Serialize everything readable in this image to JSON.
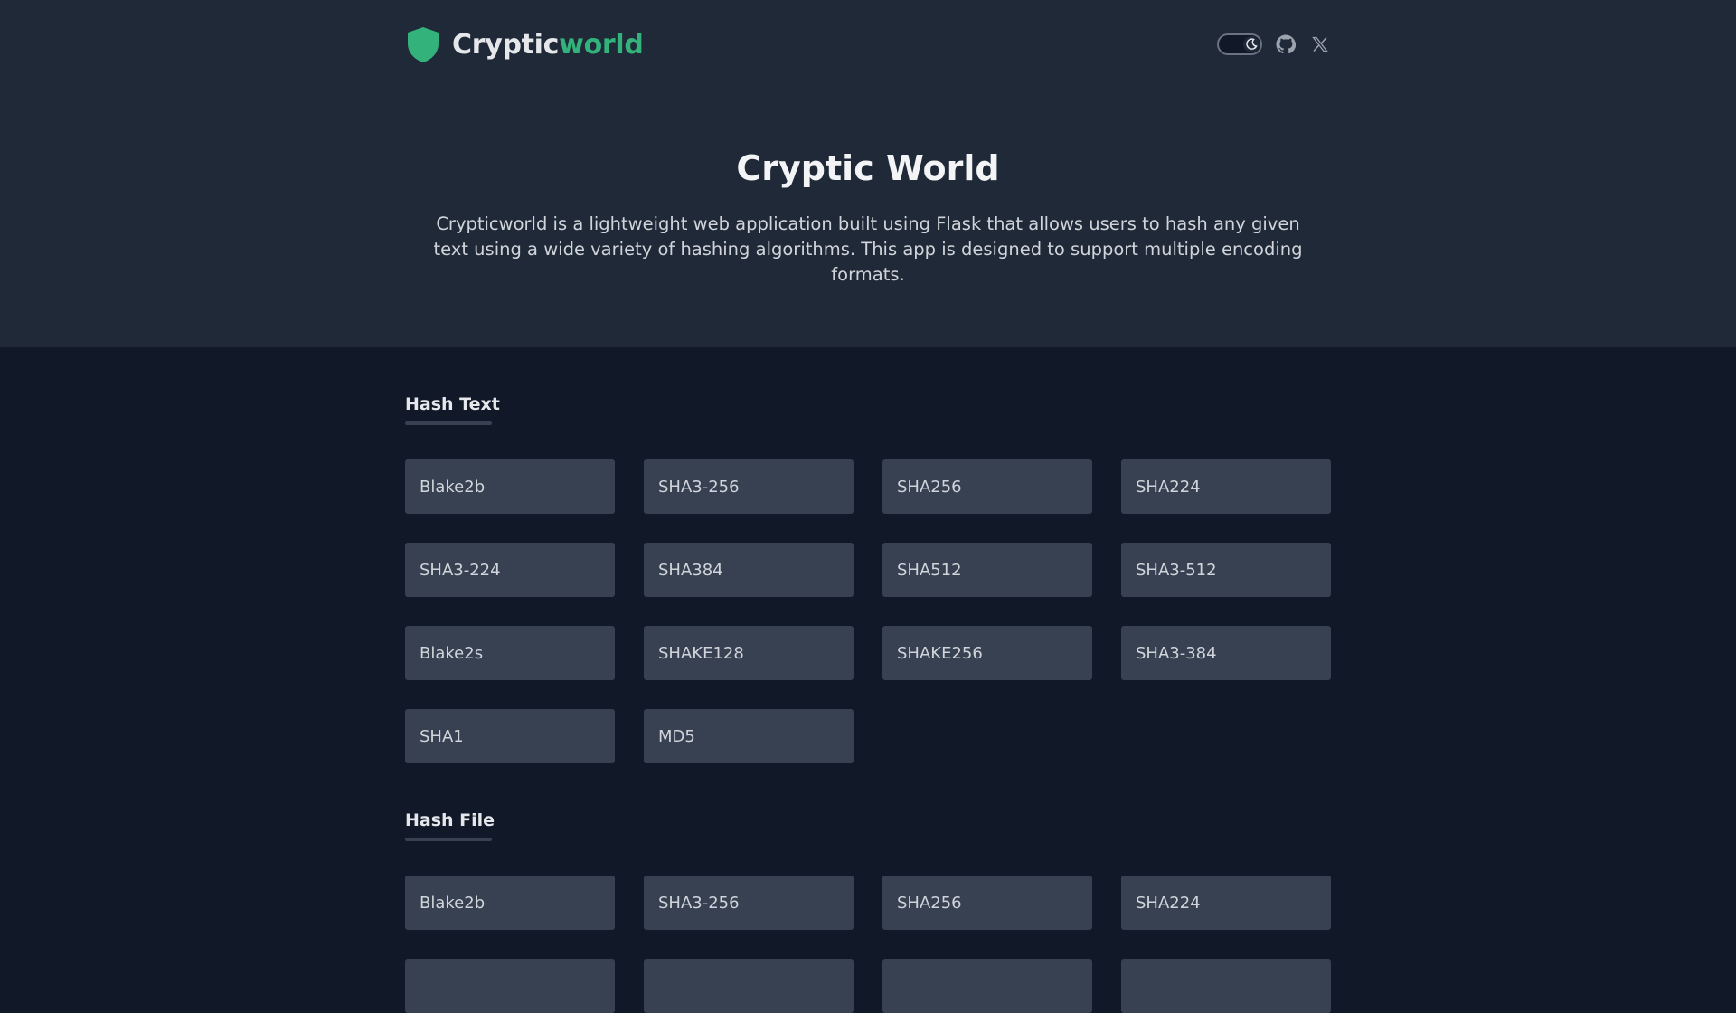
{
  "brand": {
    "name_part1": "Cryptic",
    "name_part2": "world",
    "accent_color": "#34b27b",
    "logo_icon": "shield-icon"
  },
  "header_icons": {
    "theme_toggle": "moon-icon",
    "github": "github-icon",
    "x": "x-logo-icon"
  },
  "hero": {
    "title": "Cryptic World",
    "description": "Crypticworld is a lightweight web application built using Flask that allows users to hash any given text using a wide variety of hashing algorithms. This app is designed to support multiple encoding formats."
  },
  "hash_text": {
    "title": "Hash Text",
    "items": [
      "Blake2b",
      "SHA3-256",
      "SHA256",
      "SHA224",
      "SHA3-224",
      "SHA384",
      "SHA512",
      "SHA3-512",
      "Blake2s",
      "SHAKE128",
      "SHAKE256",
      "SHA3-384",
      "SHA1",
      "MD5"
    ]
  },
  "hash_file": {
    "title": "Hash File",
    "items": [
      "Blake2b",
      "SHA3-256",
      "SHA256",
      "SHA224",
      "",
      "",
      "",
      ""
    ]
  }
}
